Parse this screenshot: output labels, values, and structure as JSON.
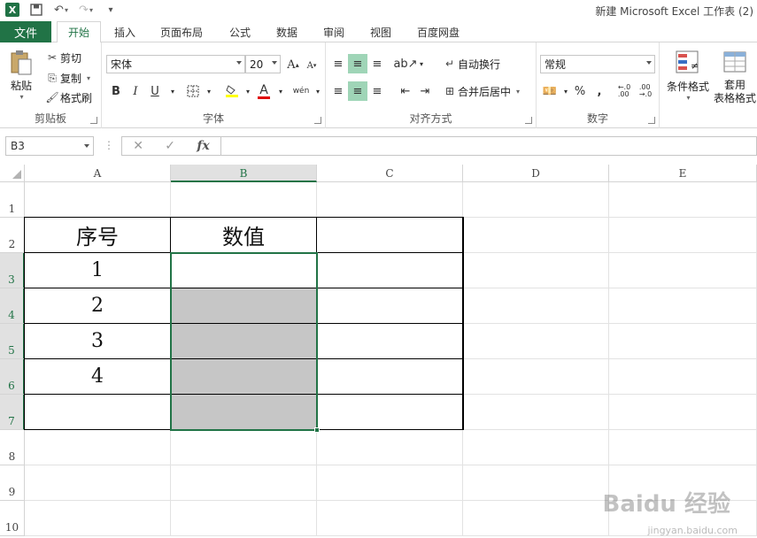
{
  "titlebar": {
    "app_icon": "X",
    "title": "新建 Microsoft Excel 工作表 (2)"
  },
  "tabs": {
    "file": "文件",
    "items": [
      "开始",
      "插入",
      "页面布局",
      "公式",
      "数据",
      "审阅",
      "视图",
      "百度网盘"
    ]
  },
  "ribbon": {
    "clipboard": {
      "label": "剪贴板",
      "paste": "粘贴",
      "cut": "剪切",
      "copy": "复制",
      "format_painter": "格式刷"
    },
    "font": {
      "label": "字体",
      "font_name": "宋体",
      "font_size": "20",
      "bold": "B",
      "italic": "I",
      "underline": "U",
      "font_color_glyph": "A",
      "phonetic": "wén"
    },
    "alignment": {
      "label": "对齐方式",
      "wrap_text": "自动换行",
      "merge_center": "合并后居中"
    },
    "number": {
      "label": "数字",
      "format": "常规",
      "percent": "%",
      "comma": ","
    },
    "styles": {
      "conditional_format_line1": "条件格式",
      "table_format_line1": "套用",
      "table_format_line2": "表格格式"
    }
  },
  "formula_bar": {
    "name_box": "B3",
    "fx_label": "fx",
    "formula": ""
  },
  "sheet": {
    "columns": [
      "A",
      "B",
      "C",
      "D",
      "E"
    ],
    "rows": [
      "1",
      "2",
      "3",
      "4",
      "5",
      "6",
      "7",
      "8",
      "9",
      "10"
    ],
    "selected_column": "B",
    "header_a": "序号",
    "header_b": "数值",
    "a3": "1",
    "a4": "2",
    "a5": "3",
    "a6": "4"
  },
  "watermark": {
    "brand": "Baidu 经验",
    "url": "jingyan.baidu.com"
  }
}
